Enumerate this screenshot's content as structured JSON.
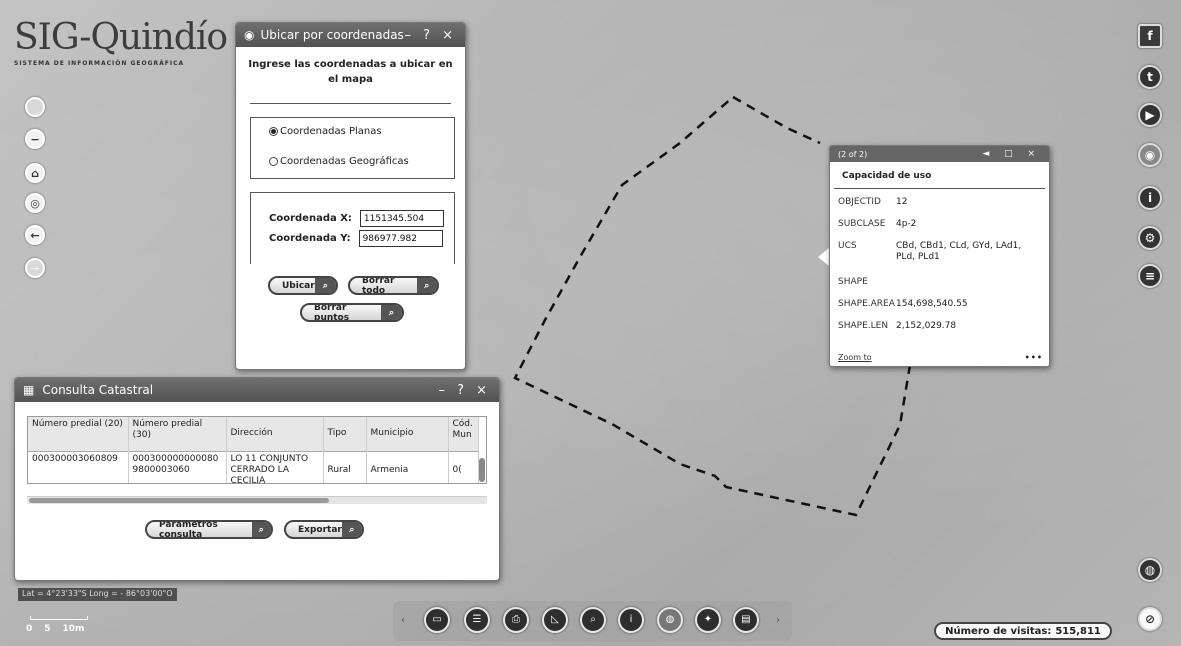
{
  "logo": {
    "title": "SIG-Quindío",
    "subtitle": "SISTEMA DE INFORMACIÓN GEOGRÁFICA"
  },
  "nav": {
    "zoom_out": "−",
    "home_icon": "home-icon",
    "locate_icon": "locate-icon",
    "back_icon": "arrow-left-icon",
    "forward_icon": "arrow-right-icon"
  },
  "coord_window": {
    "title": "Ubicar por coordenadas",
    "controls": "– ? ×",
    "heading": "Ingrese las coordenadas a ubicar en el mapa",
    "options": [
      {
        "label": "Coordenadas Planas",
        "selected": true
      },
      {
        "label": "Coordenadas Geográficas",
        "selected": false
      }
    ],
    "x_label": "Coordenada X:",
    "x_value": "1151345.504",
    "y_label": "Coordenada Y:",
    "y_value": "986977.982",
    "ubicar_label": "Ubicar",
    "borrar_todo_label": "Borrar todo",
    "borrar_puntos_label": "Borrar puntos"
  },
  "catastral_window": {
    "title": "Consulta Catastral",
    "controls": "– ? ×",
    "columns": [
      "Número predial (20)",
      "Número predial (30)",
      "Dirección",
      "Tipo",
      "Municipio",
      "Cód. Mun"
    ],
    "rows": [
      [
        "000300003060809",
        "000300000000080 9800003060",
        "LO 11 CONJUNTO CERRADO LA CECILIA",
        "Rural",
        "Armenia",
        "0("
      ]
    ],
    "parametros_label": "Parámetros consulta",
    "exportar_label": "Exportar"
  },
  "popup": {
    "counter": "(2 of 2)",
    "controls": "◄ □ ×",
    "heading": "Capacidad de uso",
    "attributes": [
      {
        "key": "OBJECTID",
        "value": "12"
      },
      {
        "key": "SUBCLASE",
        "value": "4p-2"
      },
      {
        "key": "UCS",
        "value": "CBd, CBd1, CLd, GYd, LAd1, PLd, PLd1"
      },
      {
        "key": "SHAPE",
        "value": ""
      },
      {
        "key": "SHAPE.AREA",
        "value": "154,698,540.55"
      },
      {
        "key": "SHAPE.LEN",
        "value": "2,152,029.78"
      }
    ],
    "zoom_label": "Zoom to",
    "more_label": "•••"
  },
  "map": {
    "latlong": "Lat = 4°23'33\"S Long = - 86°03'00\"O",
    "scale_labels": [
      "0",
      "5",
      "10m"
    ]
  },
  "toolbar": {
    "left_arrow": "‹",
    "right_arrow": "›",
    "buttons": [
      "capas-icon",
      "legend-icon",
      "print-icon",
      "measure-icon",
      "search-icon",
      "info-icon",
      "globe-icon",
      "gps-icon",
      "table-icon"
    ]
  },
  "side": {
    "facebook": "f",
    "twitter": "t",
    "youtube": "▶"
  },
  "visits": {
    "label": "Número de visitas:",
    "count": "515,811"
  }
}
